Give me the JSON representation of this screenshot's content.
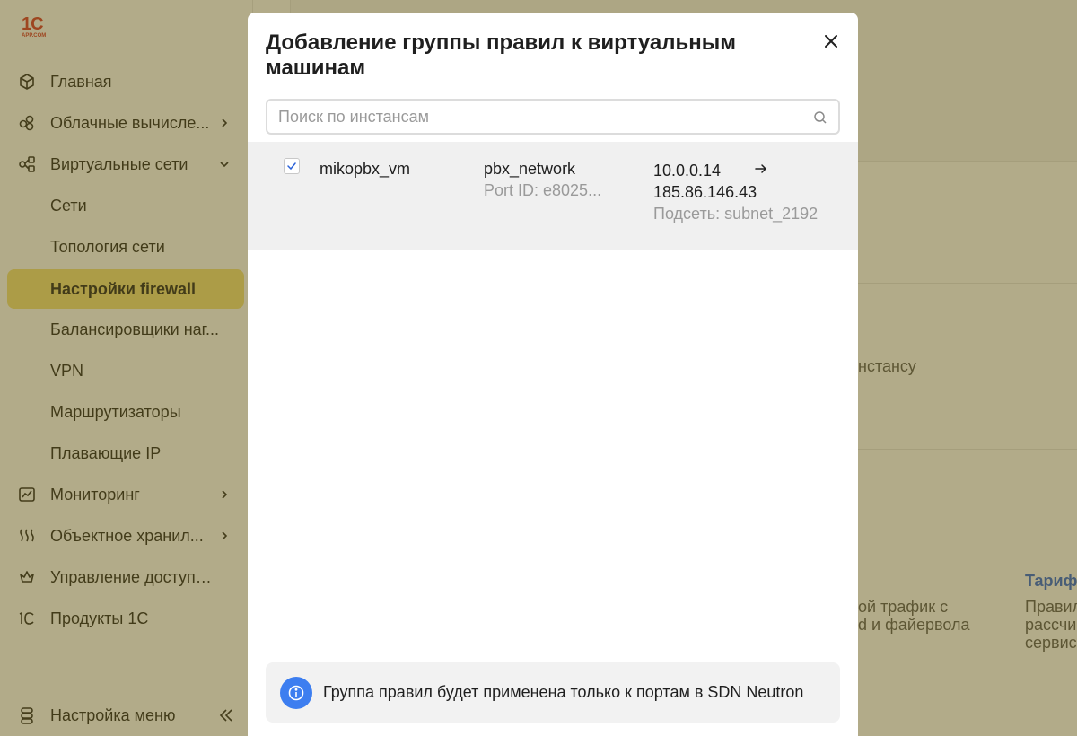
{
  "logo": {
    "line1": "1С",
    "line2": "APP.COM"
  },
  "sidebar": {
    "items": [
      {
        "label": "Главная",
        "icon": "cube-icon"
      },
      {
        "label": "Облачные вычисле...",
        "icon": "cloud-compute-icon",
        "chevron": "right"
      },
      {
        "label": "Виртуальные сети",
        "icon": "network-icon",
        "chevron": "down"
      },
      {
        "label": "Сети"
      },
      {
        "label": "Топология сети"
      },
      {
        "label": "Настройки firewall",
        "active": true
      },
      {
        "label": "Балансировщики наг..."
      },
      {
        "label": "VPN"
      },
      {
        "label": "Маршрутизаторы"
      },
      {
        "label": "Плавающие IP"
      },
      {
        "label": "Мониторинг",
        "icon": "chart-icon",
        "chevron": "right"
      },
      {
        "label": "Объектное хранил...",
        "icon": "storage-icon",
        "chevron": "right"
      },
      {
        "label": "Управление доступами",
        "icon": "crown-icon"
      },
      {
        "label": "Продукты 1С",
        "icon": "1c-icon"
      }
    ],
    "footer_label": "Настройка меню"
  },
  "background": {
    "text_instance": "нстансу",
    "text_traffic_1": "ой трафик с",
    "text_traffic_2": "d и файервола",
    "link_tariff": "Тарифы",
    "text_rules_1": "Правил",
    "text_rules_2": "рассчи",
    "text_rules_3": "сервис"
  },
  "modal": {
    "title": "Добавление группы правил к виртуальным машинам",
    "search_placeholder": "Поиск по инстансам",
    "rows": [
      {
        "checked": true,
        "name": "mikopbx_vm",
        "network": "pbx_network",
        "port": "Port ID: e8025...",
        "ip_private": "10.0.0.14",
        "ip_public": "185.86.146.43",
        "subnet": "Подсеть: subnet_2192"
      }
    ],
    "info_text": "Группа правил будет применена только к портам в SDN Neutron"
  },
  "colors": {
    "accent_active": "#f3e07a",
    "overlay": "#665814",
    "info_icon": "#3d7ef0",
    "link": "#2b62d9"
  }
}
